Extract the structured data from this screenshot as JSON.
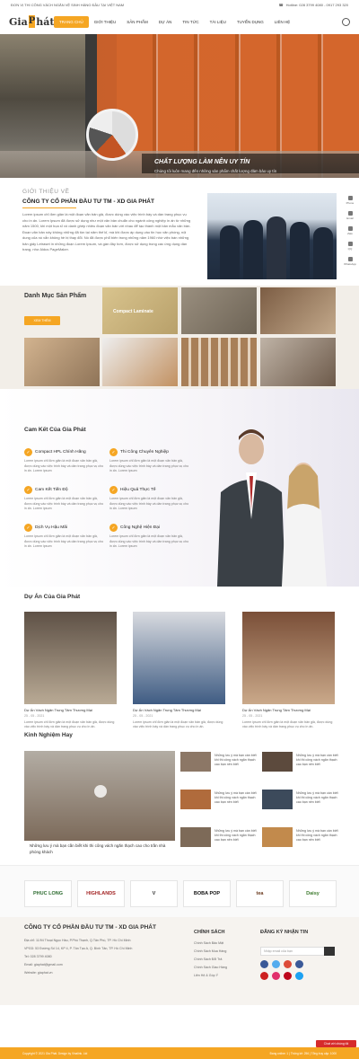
{
  "topbar": {
    "tagline": "ĐƠN VỊ THI CÔNG VÁCH NGĂN VỆ SINH HÀNG ĐẦU TẠI VIỆT NAM",
    "hotline": "Hotline: 028 3799 4080 - 0917 293 320"
  },
  "header": {
    "logo_text_1": "Gia",
    "logo_text_2": "P",
    "logo_text_3": "hát",
    "nav": [
      "TRANG CHỦ",
      "GIỚI THIỆU",
      "SẢN PHẨM",
      "DỰ ÁN",
      "TIN TỨC",
      "TÀI LIỆU",
      "TUYỂN DỤNG",
      "LIÊN HỆ"
    ]
  },
  "hero": {
    "title": "CHẤT LƯỢNG LÀM NÊN UY TÍN",
    "subtitle": "Chúng tôi luôn mang đến những sản phẩm chất lượng đảm bảo uy tín"
  },
  "side_icons": [
    "Phone",
    "Email",
    "Zalo",
    "QQ",
    "WhatsApp"
  ],
  "intro": {
    "eyebrow": "GIỚI THIỆU VỀ",
    "title": "CÔNG TY CỔ PHẦN ĐẦU TƯ TM - XD GIA PHÁT",
    "text": "Lorem ipsum chỉ đơn giản là một đoạn văn bản giả, được dùng vào việc trình bày và dàn trang phục vụ cho in ấn. Lorem Ipsum đã được sử dụng như một văn bản chuẩn cho ngành công nghiệp in ấn từ những năm 1500, khi một họa sĩ vô danh ghép nhiều đoạn văn bản với nhau để tạo thành một bản mẫu văn bản. Đoạn văn bản này không những đã tồn tại năm thế kỉ, mà khi được áp dụng vào tin học văn phòng, nội dung của nó vẫn không hề bị thay đổi. Nó đã được phổ biến trong những năm 1960 nhờ việc bán những bản giấy Letraset in những đoạn Lorem Ipsum, và gần đây hơn, được sử dụng trong các ứng dụng dàn trang, như Aldus PageMaker."
  },
  "catalog": {
    "title": "Danh Mục Sản Phẩm",
    "more_label": "XEM THÊM",
    "feature_caption": "Compact Laminate"
  },
  "commit": {
    "title": "Cam Kết Của Gia Phát",
    "features": [
      {
        "label": "Compact HPL Chính Hãng",
        "desc": "Lorem ipsum chỉ đơn giản là một đoạn văn bản giả, được dùng vào việc trình bày và dàn trang phục vụ cho in ấn. Lorem ipsum"
      },
      {
        "label": "Thi Công Chuyên Nghiệp",
        "desc": "Lorem ipsum chỉ đơn giản là một đoạn văn bản giả, được dùng vào việc trình bày và dàn trang phục vụ cho in ấn. Lorem ipsum"
      },
      {
        "label": "Cam Kết Tiến Độ",
        "desc": "Lorem ipsum chỉ đơn giản là một đoạn văn bản giả, được dùng vào việc trình bày và dàn trang phục vụ cho in ấn. Lorem ipsum"
      },
      {
        "label": "Hiệu Quả Thực Tế",
        "desc": "Lorem ipsum chỉ đơn giản là một đoạn văn bản giả, được dùng vào việc trình bày và dàn trang phục vụ cho in ấn. Lorem ipsum"
      },
      {
        "label": "Dịch Vụ Hậu Mãi",
        "desc": "Lorem ipsum chỉ đơn giản là một đoạn văn bản giả, được dùng vào việc trình bày và dàn trang phục vụ cho in ấn. Lorem ipsum"
      },
      {
        "label": "Công Nghệ Hiện Đại",
        "desc": "Lorem ipsum chỉ đơn giản là một đoạn văn bản giả, được dùng vào việc trình bày và dàn trang phục vụ cho in ấn. Lorem ipsum"
      }
    ]
  },
  "projects": {
    "title": "Dự Án Của Gia Phát",
    "items": [
      {
        "title": "Dự Án Vách Ngăn Trung Tâm Thương Mại",
        "date": "25 - 05 - 2021",
        "desc": "Lorem ipsum chỉ đơn giản là một đoạn văn bản giả, được dùng vào việc trình bày và dàn trang phục vụ cho in ấn."
      },
      {
        "title": "Dự Án Vách Ngăn Trung Tâm Thương Mại",
        "date": "25 - 05 - 2021",
        "desc": "Lorem ipsum chỉ đơn giản là một đoạn văn bản giả, được dùng vào việc trình bày và dàn trang phục vụ cho in ấn."
      },
      {
        "title": "Dự Án Vách Ngăn Trung Tâm Thương Mại",
        "date": "25 - 05 - 2021",
        "desc": "Lorem ipsum chỉ đơn giản là một đoạn văn bản giả, được dùng vào việc trình bày và dàn trang phục vụ cho in ấn."
      }
    ]
  },
  "experience": {
    "title": "Kinh Nghiệm Hay",
    "big_caption": "Những lưu ý mà bạn cần biết khi thi công vách ngăn thạch cao cho trần nhà phòng khách",
    "items": [
      "Những lưu ý mà bạn cần biết khi thi công vách ngăn thạch cao bạn nên biết",
      "Những lưu ý mà bạn cần biết khi thi công vách ngăn thạch cao bạn nên biết",
      "Những lưu ý mà bạn cần biết khi thi công vách ngăn thạch cao bạn nên biết",
      "Những lưu ý mà bạn cần biết khi thi công vách ngăn thạch cao bạn nên biết",
      "Những lưu ý mà bạn cần biết khi thi công vách ngăn thạch cao bạn nên biết",
      "Những lưu ý mà bạn cần biết khi thi công vách ngăn thạch cao bạn nên biết"
    ]
  },
  "brands": [
    "PHUC LONG",
    "HIGHLANDS",
    "V",
    "BOBA POP",
    "tea",
    "Daisy"
  ],
  "footer": {
    "company": "CÔNG TY CỔ PHẦN ĐẦU TƯ TM - XD GIA PHÁT",
    "address_1": "Địa chỉ: 11/94 Thoại Ngọc Hầu, P.Phú Thạnh, Q.Tân Phú, TP. Hồ Chí Minh",
    "address_2": "VPGD: 53 Đường Số 14, KP 4, P. Tân Tạo A, Q. Bình Tân, TP. Hồ Chí Minh",
    "phone": "Tel: 028 3799 4080",
    "email": "Email: giaphat@gmail.com",
    "website": "Website: giaphat.vn",
    "policy_title": "CHÍNH SÁCH",
    "policies": [
      "Chính Sách Bảo Mật",
      "Chính Sách Mua Hàng",
      "Chính Sách Đổi Trả",
      "Chính Sách Giao Hàng",
      "Liên Hệ & Góp Ý"
    ],
    "newsletter_title": "ĐĂNG KÝ NHẬN TIN",
    "newsletter_placeholder": "Nhập email của bạn",
    "copyright": "Copyright © 2021 Gia Phát. Design by Vinalink. Ltd",
    "online": "Đang online: 1  |  Thống kê: 256  |  Tổng truy cập: 1000",
    "chat": "Chat với chúng tôi"
  },
  "colors": {
    "accent": "#f5a623",
    "dark": "#333333"
  }
}
